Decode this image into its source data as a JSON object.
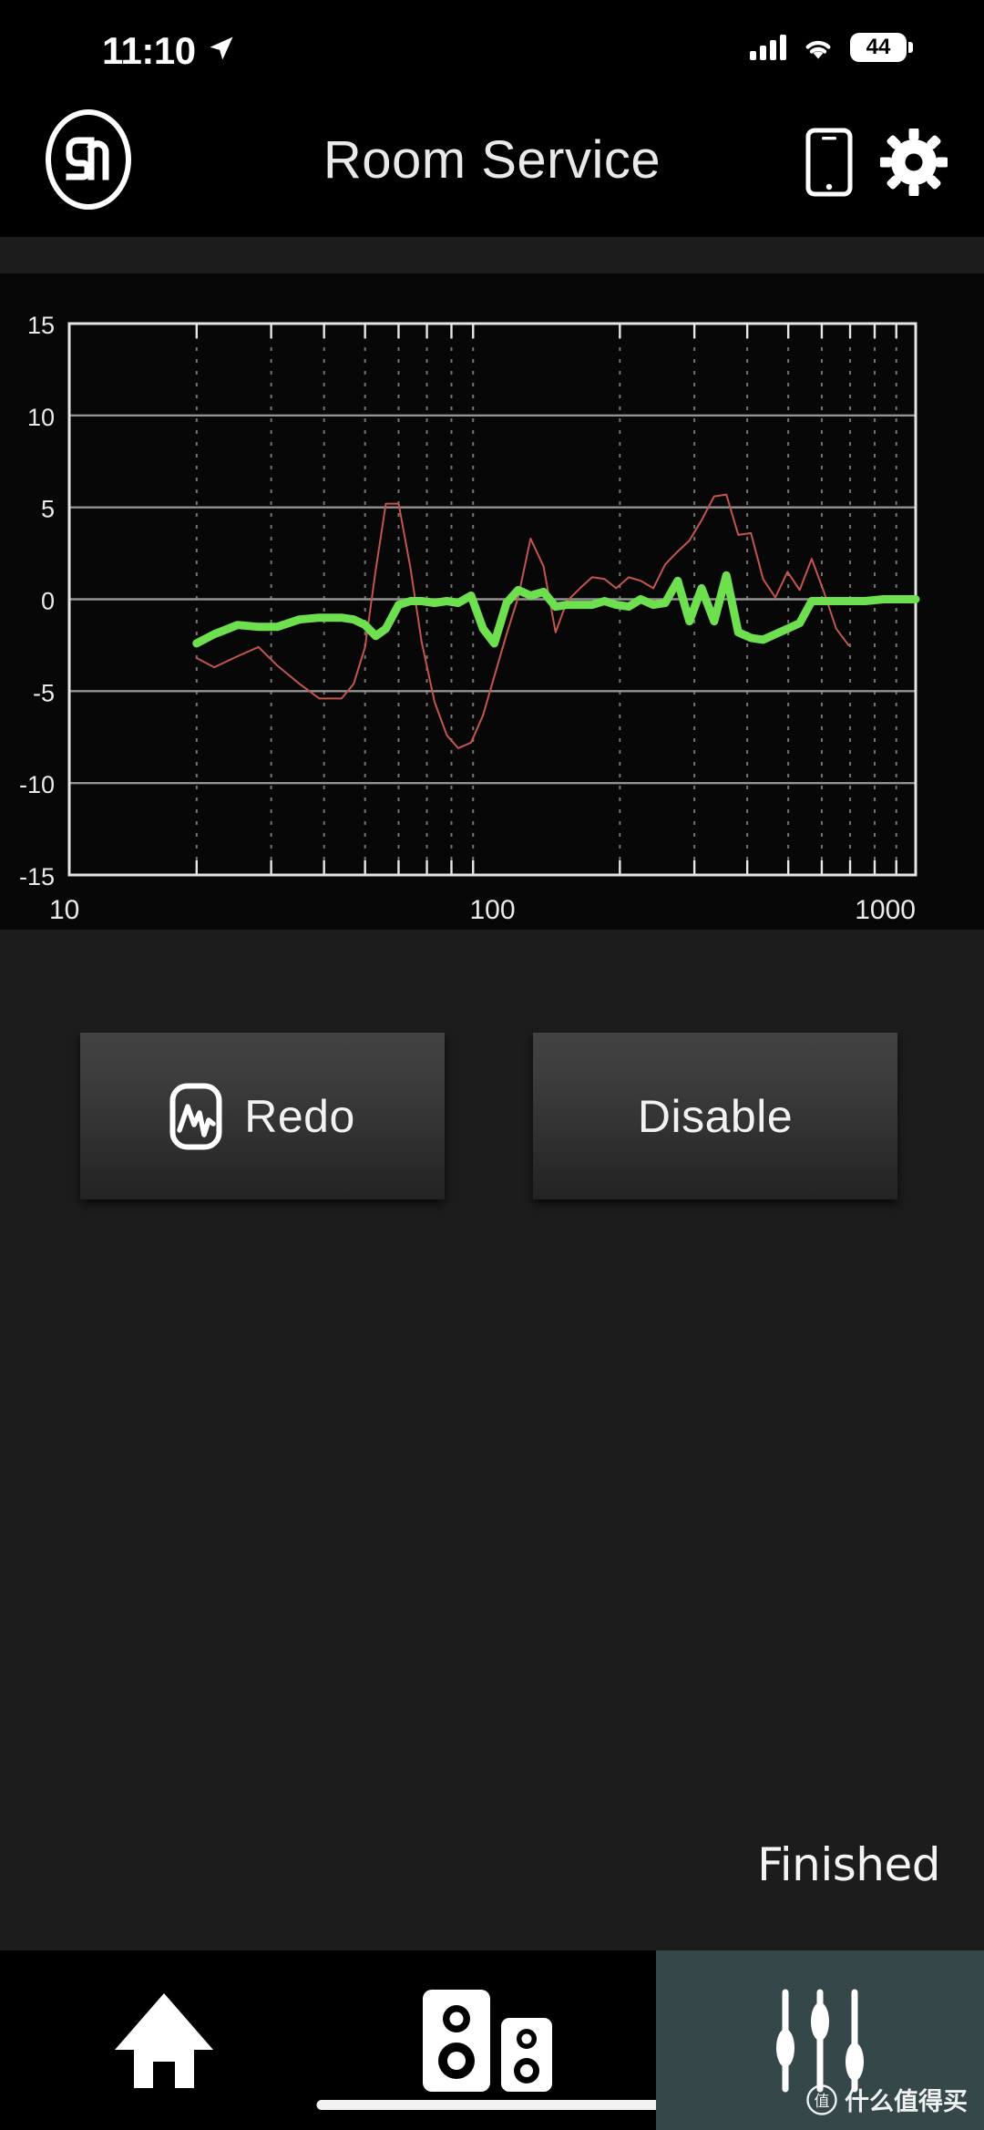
{
  "status_bar": {
    "time": "11:10",
    "location_icon": "location-arrow-icon",
    "signal_icon": "cellular-signal-icon",
    "wifi_icon": "wifi-icon",
    "battery_level": "44",
    "battery_icon": "battery-icon"
  },
  "header": {
    "logo_text": "Sa",
    "logo_icon": "sonarworks-logo-icon",
    "title": "Room Service",
    "phone_icon": "phone-device-icon",
    "settings_icon": "gear-icon"
  },
  "buttons": {
    "redo_label": "Redo",
    "redo_icon": "waveform-icon",
    "disable_label": "Disable"
  },
  "status_message": "Finished",
  "bottom_nav": {
    "items": [
      {
        "name": "home",
        "icon": "home-icon",
        "active": false
      },
      {
        "name": "speakers",
        "icon": "speakers-icon",
        "active": false
      },
      {
        "name": "calibration",
        "icon": "sliders-icon",
        "active": true
      }
    ]
  },
  "watermark": {
    "badge": "值",
    "text": "什么值得买"
  },
  "colors": {
    "measured_line": "#c2564e",
    "corrected_line": "#6ee04f",
    "grid_major": "#9a9a9a",
    "grid_minor": "#888888",
    "axis": "#e6e6e6",
    "background": "#070707",
    "page_background": "#1c1c1c",
    "nav_active": "#36474a"
  },
  "chart_data": {
    "type": "line",
    "title": "",
    "xlabel": "",
    "ylabel": "",
    "xscale": "log",
    "xlim": [
      10,
      1000
    ],
    "ylim": [
      -15,
      15
    ],
    "grid": true,
    "legend": "none",
    "yticks": [
      15,
      10,
      5,
      0,
      -5,
      -10,
      -15
    ],
    "xticks": [
      10,
      100,
      1000
    ],
    "xminor_ticks": [
      20,
      30,
      40,
      50,
      60,
      70,
      80,
      90,
      200,
      300,
      400,
      500,
      600,
      700,
      800,
      900
    ],
    "x": [
      20,
      22,
      25,
      28,
      31,
      35,
      39,
      44,
      49,
      55,
      62,
      69,
      77,
      87,
      97,
      109,
      122,
      137,
      154,
      172,
      193,
      217,
      243,
      273,
      306,
      343,
      385,
      432,
      485,
      544,
      610,
      684,
      768,
      861,
      966,
      1000
    ],
    "series": [
      {
        "name": "measured",
        "color": "#c2564e",
        "width": 2,
        "values": [
          -3.2,
          -3.6,
          -3.0,
          -2.5,
          -3.5,
          -4.5,
          -5.3,
          -5.3,
          -3.8,
          -2.4,
          5.2,
          5.2,
          -0.6,
          -3.5,
          -6.9,
          -8.1,
          -7.3,
          -4.4,
          -1.4,
          0.6,
          1.1,
          0.8,
          1.4,
          0.1,
          2.2,
          3.6,
          5.7,
          5.5,
          2.8,
          2.9,
          0.3,
          1.5,
          0.7,
          1.9,
          -1.3,
          -2.6
        ]
      },
      {
        "name": "corrected",
        "color": "#6ee04f",
        "width": 9,
        "values": [
          -2.4,
          -1.9,
          -1.3,
          -1.5,
          -1.5,
          -1.1,
          -1.0,
          -1.0,
          -1.3,
          -1.9,
          -0.2,
          -0.1,
          -0.2,
          0.0,
          -0.1,
          -0.1,
          -0.2,
          -0.1,
          0.0,
          -0.1,
          -0.1,
          -0.2,
          -0.1,
          -0.2,
          -0.1,
          -0.2,
          -0.1,
          0.0,
          -0.1,
          -0.1,
          -0.1,
          0.0,
          -0.1,
          0.0,
          0.0,
          0.0
        ]
      }
    ],
    "measured_x": [
      20,
      22,
      25,
      28,
      31,
      35,
      39,
      44,
      47,
      50,
      53,
      56,
      60,
      64,
      68,
      73,
      78,
      83,
      89,
      95,
      101,
      108,
      115,
      123,
      132,
      141,
      150,
      161,
      172,
      184,
      196,
      210,
      224,
      240,
      256,
      274,
      292,
      312,
      334,
      357,
      381,
      408,
      436,
      466,
      498,
      532,
      568,
      607,
      649,
      694
    ],
    "measured_y": [
      -3.2,
      -3.7,
      -3.1,
      -2.6,
      -3.6,
      -4.6,
      -5.4,
      -5.4,
      -4.6,
      -2.6,
      1.6,
      5.2,
      5.2,
      1.7,
      -2.3,
      -5.6,
      -7.4,
      -8.1,
      -7.8,
      -6.3,
      -4.2,
      -1.9,
      0.1,
      3.3,
      1.8,
      -1.8,
      -0.1,
      0.6,
      1.2,
      1.1,
      0.6,
      1.2,
      1.0,
      0.6,
      1.9,
      2.6,
      3.2,
      4.3,
      5.6,
      5.7,
      3.5,
      3.6,
      1.1,
      0.1,
      1.5,
      0.5,
      2.2,
      0.4,
      -1.6,
      -2.5
    ],
    "corrected_x": [
      20,
      22,
      25,
      28,
      31,
      35,
      39,
      44,
      47,
      50,
      53,
      56,
      60,
      64,
      68,
      73,
      78,
      83,
      89,
      95,
      101,
      108,
      115,
      123,
      132,
      141,
      150,
      161,
      172,
      184,
      196,
      210,
      224,
      240,
      256,
      274,
      292,
      312,
      334,
      357,
      381,
      408,
      436,
      466,
      498,
      532,
      568,
      607,
      649,
      694,
      760,
      840,
      930,
      1000
    ],
    "corrected_y": [
      -2.4,
      -1.9,
      -1.4,
      -1.5,
      -1.5,
      -1.1,
      -1.0,
      -1.0,
      -1.1,
      -1.4,
      -2.0,
      -1.6,
      -0.3,
      -0.1,
      -0.1,
      -0.2,
      -0.1,
      -0.2,
      0.2,
      -1.6,
      -2.4,
      -0.2,
      0.5,
      0.2,
      0.4,
      -0.4,
      -0.3,
      -0.3,
      -0.3,
      -0.1,
      -0.3,
      -0.4,
      0.0,
      -0.3,
      -0.2,
      1.0,
      -1.2,
      0.6,
      -1.2,
      1.3,
      -1.8,
      -2.1,
      -2.2,
      -1.9,
      -1.6,
      -1.3,
      -0.1,
      -0.1,
      -0.1,
      -0.1,
      -0.1,
      0.0,
      0.0,
      0.0
    ]
  }
}
